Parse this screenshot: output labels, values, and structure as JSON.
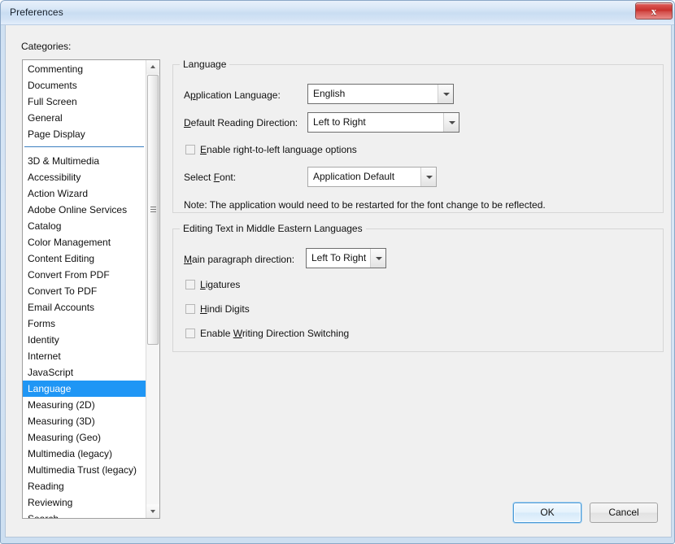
{
  "window": {
    "title": "Preferences",
    "close_icon": "close-icon",
    "close_glyph": "x"
  },
  "sidebar": {
    "label": "Categories:",
    "selected": "Language",
    "top_items": [
      "Commenting",
      "Documents",
      "Full Screen",
      "General",
      "Page Display"
    ],
    "items": [
      "3D & Multimedia",
      "Accessibility",
      "Action Wizard",
      "Adobe Online Services",
      "Catalog",
      "Color Management",
      "Content Editing",
      "Convert From PDF",
      "Convert To PDF",
      "Email Accounts",
      "Forms",
      "Identity",
      "Internet",
      "JavaScript",
      "Language",
      "Measuring (2D)",
      "Measuring (3D)",
      "Measuring (Geo)",
      "Multimedia (legacy)",
      "Multimedia Trust (legacy)",
      "Reading",
      "Reviewing",
      "Search"
    ],
    "scrollbar": {
      "up_icon": "scroll-up-arrow-icon",
      "down_icon": "scroll-down-arrow-icon",
      "thumb_icon": "scrollbar-thumb"
    }
  },
  "language_group": {
    "title": "Language",
    "app_language": {
      "label_pre": "A",
      "label_accel": "p",
      "label_post": "plication Language:",
      "value": "English"
    },
    "reading_direction": {
      "label_pre": "",
      "label_accel": "D",
      "label_post": "efault Reading Direction:",
      "value": "Left to Right"
    },
    "rtl_checkbox": {
      "pre": "",
      "accel": "E",
      "post": "nable right-to-left language options",
      "checked": false
    },
    "select_font": {
      "label_pre": "Select ",
      "label_accel": "F",
      "label_post": "ont:",
      "value": "Application Default"
    },
    "note": "Note: The application would need to be restarted for the font change to be reflected."
  },
  "middle_east_group": {
    "title": "Editing Text in Middle Eastern Languages",
    "paragraph_direction": {
      "label_pre": "",
      "label_accel": "M",
      "label_post": "ain paragraph direction:",
      "value": "Left To Right"
    },
    "checkboxes": [
      {
        "pre": "",
        "accel": "L",
        "post": "igatures",
        "checked": false
      },
      {
        "pre": "",
        "accel": "H",
        "post": "indi Digits",
        "checked": false
      },
      {
        "pre": "Enable ",
        "accel": "W",
        "post": "riting Direction Switching",
        "checked": false
      }
    ]
  },
  "footer": {
    "ok_label": "OK",
    "cancel_label": "Cancel"
  },
  "colors": {
    "selection_blue": "#1f96f5",
    "separator_blue": "#3c7fc0",
    "dialog_bg": "#f0f0f0",
    "close_red": "#c7302c"
  }
}
